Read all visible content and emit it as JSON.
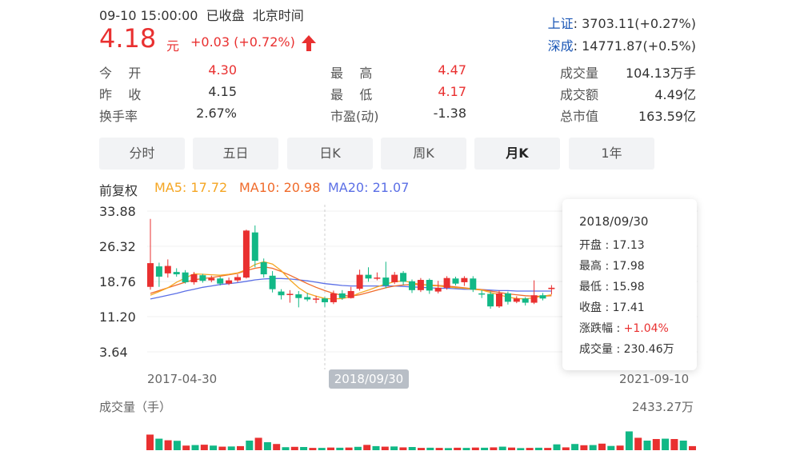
{
  "header": {
    "datetime": "09-10 15:00:00  已收盘  北京时间",
    "price": "4.18",
    "unit": "元",
    "change": "+0.03 (+0.72%)",
    "up_color": "#e93030",
    "down_color": "#12b886"
  },
  "indices": [
    {
      "name": "上证",
      "value": ": 3703.11(+0.27%)"
    },
    {
      "name": "深成",
      "value": ": 14771.87(+0.5%)"
    }
  ],
  "stats": {
    "open_label": "今    开",
    "open_value": "4.30",
    "prev_label": "昨    收",
    "prev_value": "4.15",
    "turnover_label": "换手率",
    "turnover_value": "2.67%",
    "high_label": "最    高",
    "high_value": "4.47",
    "low_label": "最    低",
    "low_value": "4.17",
    "pe_label": "市盈(动)",
    "pe_value": "-1.38",
    "volume_label": "成交量",
    "volume_value": "104.13万手",
    "amount_label": "成交额",
    "amount_value": "4.49亿",
    "mcap_label": "总市值",
    "mcap_value": "163.59亿"
  },
  "tabs": [
    "分时",
    "五日",
    "日K",
    "周K",
    "月K",
    "1年"
  ],
  "active_tab": "月K",
  "ma_bar": {
    "adjust": "前复权",
    "ma5": "MA5: 17.72",
    "ma10": "MA10: 20.98",
    "ma20": "MA20: 21.07",
    "ma5_color": "#f5a623",
    "ma10_color": "#f06b2b",
    "ma20_color": "#5b6fe6"
  },
  "chart_data": {
    "type": "candlestick",
    "y_ticks": [
      "33.88",
      "26.32",
      "18.76",
      "11.20",
      "3.64"
    ],
    "ylim": [
      3.64,
      33.88
    ],
    "x_labels": [
      "2017-04-30",
      "2021-09-10"
    ],
    "crosshair_label": "2018/09/30",
    "candles": [
      {
        "o": 17.6,
        "c": 22.7,
        "h": 32.2,
        "l": 17.0
      },
      {
        "o": 22.0,
        "c": 19.8,
        "h": 22.8,
        "l": 17.6
      },
      {
        "o": 20.5,
        "c": 22.1,
        "h": 23.5,
        "l": 19.6
      },
      {
        "o": 20.8,
        "c": 20.3,
        "h": 21.6,
        "l": 19.8
      },
      {
        "o": 20.7,
        "c": 18.6,
        "h": 21.2,
        "l": 18.3
      },
      {
        "o": 18.6,
        "c": 20.3,
        "h": 20.8,
        "l": 18.1
      },
      {
        "o": 20.1,
        "c": 18.9,
        "h": 20.4,
        "l": 18.5
      },
      {
        "o": 19.0,
        "c": 19.5,
        "h": 20.0,
        "l": 18.6
      },
      {
        "o": 19.4,
        "c": 18.3,
        "h": 19.8,
        "l": 17.9
      },
      {
        "o": 18.3,
        "c": 19.0,
        "h": 19.6,
        "l": 18.0
      },
      {
        "o": 19.0,
        "c": 19.7,
        "h": 20.3,
        "l": 18.6
      },
      {
        "o": 19.6,
        "c": 29.7,
        "h": 29.9,
        "l": 19.4
      },
      {
        "o": 29.3,
        "c": 23.2,
        "h": 30.8,
        "l": 21.8
      },
      {
        "o": 22.9,
        "c": 20.3,
        "h": 23.7,
        "l": 19.6
      },
      {
        "o": 20.0,
        "c": 17.1,
        "h": 21.0,
        "l": 16.4
      },
      {
        "o": 16.6,
        "c": 15.8,
        "h": 17.1,
        "l": 14.9
      },
      {
        "o": 15.9,
        "c": 16.1,
        "h": 16.9,
        "l": 14.2
      },
      {
        "o": 16.0,
        "c": 15.2,
        "h": 16.7,
        "l": 13.2
      },
      {
        "o": 15.4,
        "c": 14.9,
        "h": 16.3,
        "l": 14.5
      },
      {
        "o": 14.9,
        "c": 15.1,
        "h": 15.7,
        "l": 14.1
      },
      {
        "o": 15.1,
        "c": 14.3,
        "h": 15.4,
        "l": 13.3
      },
      {
        "o": 14.3,
        "c": 16.2,
        "h": 16.8,
        "l": 13.9
      },
      {
        "o": 16.2,
        "c": 15.2,
        "h": 16.9,
        "l": 14.8
      },
      {
        "o": 15.2,
        "c": 16.7,
        "h": 17.6,
        "l": 15.1
      },
      {
        "o": 17.2,
        "c": 20.2,
        "h": 21.3,
        "l": 16.8
      },
      {
        "o": 20.2,
        "c": 19.4,
        "h": 21.8,
        "l": 18.7
      },
      {
        "o": 19.5,
        "c": 19.6,
        "h": 20.7,
        "l": 19.0
      },
      {
        "o": 19.6,
        "c": 17.9,
        "h": 23.0,
        "l": 17.3
      },
      {
        "o": 18.6,
        "c": 20.2,
        "h": 20.8,
        "l": 18.2
      },
      {
        "o": 20.6,
        "c": 18.7,
        "h": 21.0,
        "l": 18.0
      },
      {
        "o": 18.8,
        "c": 16.9,
        "h": 19.2,
        "l": 16.3
      },
      {
        "o": 16.9,
        "c": 19.1,
        "h": 19.5,
        "l": 16.5
      },
      {
        "o": 19.1,
        "c": 16.8,
        "h": 19.4,
        "l": 16.1
      },
      {
        "o": 16.6,
        "c": 17.4,
        "h": 18.9,
        "l": 16.2
      },
      {
        "o": 17.4,
        "c": 19.5,
        "h": 19.9,
        "l": 17.0
      },
      {
        "o": 19.4,
        "c": 18.3,
        "h": 19.8,
        "l": 17.9
      },
      {
        "o": 18.6,
        "c": 19.5,
        "h": 19.9,
        "l": 17.8
      },
      {
        "o": 19.4,
        "c": 17.0,
        "h": 19.9,
        "l": 16.5
      },
      {
        "o": 16.2,
        "c": 16.1,
        "h": 16.9,
        "l": 15.2
      },
      {
        "o": 16.1,
        "c": 13.4,
        "h": 16.6,
        "l": 12.9
      },
      {
        "o": 13.4,
        "c": 16.2,
        "h": 16.8,
        "l": 13.1
      },
      {
        "o": 16.2,
        "c": 14.4,
        "h": 16.6,
        "l": 13.8
      },
      {
        "o": 14.4,
        "c": 15.1,
        "h": 15.6,
        "l": 14.1
      },
      {
        "o": 15.1,
        "c": 14.2,
        "h": 15.4,
        "l": 13.6
      },
      {
        "o": 14.2,
        "c": 15.8,
        "h": 19.0,
        "l": 13.9
      },
      {
        "o": 15.8,
        "c": 15.1,
        "h": 16.3,
        "l": 14.7
      },
      {
        "o": 17.13,
        "c": 17.41,
        "h": 17.98,
        "l": 15.98
      }
    ],
    "ma5": [
      15.8,
      16.6,
      17.4,
      18.6,
      19.5,
      20.4,
      20.3,
      20.2,
      20.1,
      20.3,
      20.6,
      21.3,
      22.4,
      23.0,
      22.5,
      21.1,
      19.1,
      17.4,
      16.2,
      15.6,
      15.1,
      15.0,
      15.1,
      15.5,
      16.3,
      16.9,
      17.6,
      18.2,
      18.7,
      18.9,
      18.5,
      18.1,
      17.9,
      17.8,
      17.6,
      17.4,
      17.3,
      17.1,
      16.9,
      16.4,
      15.9,
      15.4,
      15.1,
      15.0,
      15.3,
      15.6,
      15.9
    ],
    "ma10": [
      16.2,
      16.8,
      17.4,
      18.0,
      18.6,
      19.1,
      19.4,
      19.6,
      19.9,
      20.2,
      20.5,
      21.1,
      21.6,
      21.9,
      21.6,
      20.9,
      20.1,
      19.2,
      18.3,
      17.5,
      16.8,
      16.2,
      15.8,
      15.6,
      15.9,
      16.4,
      16.9,
      17.4,
      17.8,
      18.0,
      18.1,
      18.1,
      18.0,
      17.9,
      17.8,
      17.6,
      17.4,
      17.2,
      17.0,
      16.7,
      16.4,
      16.1,
      15.9,
      15.7,
      15.6,
      15.6,
      15.7
    ],
    "ma20": [
      15.0,
      15.4,
      15.8,
      16.2,
      16.7,
      17.1,
      17.5,
      17.8,
      18.1,
      18.3,
      18.5,
      18.8,
      19.1,
      19.3,
      19.4,
      19.4,
      19.3,
      19.1,
      18.9,
      18.6,
      18.3,
      18.1,
      17.9,
      17.8,
      17.8,
      17.8,
      17.8,
      17.8,
      17.8,
      17.7,
      17.6,
      17.5,
      17.4,
      17.3,
      17.3,
      17.2,
      17.1,
      17.1,
      17.0,
      16.9,
      16.8,
      16.8,
      16.7,
      16.7,
      16.7,
      16.7,
      16.7
    ]
  },
  "tooltip": {
    "date": "2018/09/30",
    "open": "开盘 : 17.13",
    "high": "最高 : 17.98",
    "low": "最低 : 15.98",
    "close": "收盘 : 17.41",
    "change_label": "涨跌幅 : ",
    "change_value": "+1.04%",
    "volume": "成交量 : 230.46万"
  },
  "volume_chart": {
    "label": "成交量（手）",
    "max_label": "2433.27万",
    "max": 2433.27,
    "values": [
      880,
      650,
      560,
      530,
      260,
      290,
      310,
      260,
      200,
      210,
      230,
      540,
      700,
      450,
      350,
      170,
      190,
      180,
      130,
      130,
      150,
      140,
      150,
      190,
      300,
      230,
      200,
      210,
      160,
      180,
      130,
      140,
      130,
      120,
      140,
      130,
      150,
      140,
      160,
      200,
      150,
      120,
      130,
      140,
      130,
      330,
      160,
      350,
      280,
      290,
      370,
      240,
      260,
      1060,
      700,
      540,
      630,
      650,
      630,
      540,
      230
    ]
  }
}
